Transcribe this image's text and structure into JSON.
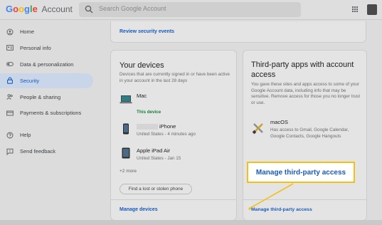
{
  "header": {
    "logo_text": "Google",
    "product": "Account",
    "search_placeholder": "Search Google Account"
  },
  "sidebar": {
    "items": [
      {
        "label": "Home",
        "icon": "home-icon"
      },
      {
        "label": "Personal info",
        "icon": "id-card-icon"
      },
      {
        "label": "Data & personalization",
        "icon": "toggle-icon"
      },
      {
        "label": "Security",
        "icon": "lock-icon",
        "active": true
      },
      {
        "label": "People & sharing",
        "icon": "people-icon"
      },
      {
        "label": "Payments & subscriptions",
        "icon": "credit-card-icon"
      },
      {
        "label": "Help",
        "icon": "help-icon"
      },
      {
        "label": "Send feedback",
        "icon": "feedback-icon"
      }
    ]
  },
  "security_events": {
    "link": "Review security events"
  },
  "devices": {
    "title": "Your devices",
    "description": "Devices that are currently signed in or have been active in your account in the last 28 days",
    "items": [
      {
        "name": "Mac",
        "meta": "This device"
      },
      {
        "name": "iPhone",
        "meta": "United States - 4 minutes ago"
      },
      {
        "name": "Apple iPad Air",
        "meta": "United States - Jan 15"
      }
    ],
    "more": "+2 more",
    "find_button": "Find a lost or stolen phone",
    "manage_link": "Manage devices"
  },
  "third_party": {
    "title": "Third-party apps with account access",
    "description": "You gave these sites and apps access to some of your Google Account data, including info that may be sensitive. Remove access for those you no longer trust or use.",
    "app_name": "macOS",
    "app_meta": "Has access to Gmail, Google Calendar, Google Contacts, Google Hangouts",
    "manage_link": "Manage third-party access",
    "callout": "Manage third-party access"
  },
  "colors": {
    "accent": "#1a5bb8",
    "highlight": "#f3c017",
    "active_nav_bg": "#c9d6ea"
  }
}
